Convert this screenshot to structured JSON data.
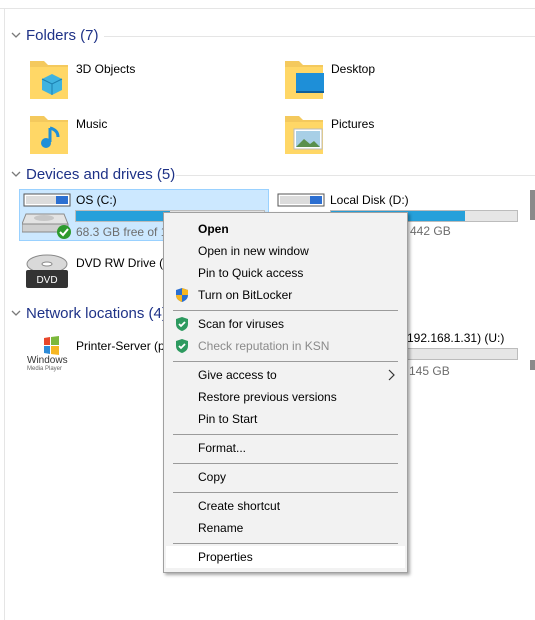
{
  "sections": {
    "folders": "Folders (7)",
    "devices": "Devices and drives (5)",
    "network": "Network locations (4)"
  },
  "folders": [
    {
      "label": "3D Objects",
      "icon": "3d-objects-folder-icon"
    },
    {
      "label": "Desktop",
      "icon": "desktop-folder-icon"
    },
    {
      "label": "Music",
      "icon": "music-folder-icon"
    },
    {
      "label": "Pictures",
      "icon": "pictures-folder-icon"
    }
  ],
  "drives": {
    "os": {
      "label": "OS (C:)",
      "free": "68.3 GB free of 1",
      "used_fraction": 0.5
    },
    "local_d": {
      "label": "Local Disk (D:)",
      "free": "442 GB",
      "used_fraction": 0.8
    },
    "dvd": {
      "label": "DVD RW Drive (G"
    },
    "dvd_icon_text": "DVD"
  },
  "network": {
    "printer": {
      "label": "Printer-Server (p",
      "logo_line1": "Windows",
      "logo_line2": "Media Player"
    },
    "share": {
      "label": "(192.168.1.31) (U:)",
      "free": "145 GB"
    }
  },
  "context_menu": {
    "open": "Open",
    "open_new_window": "Open in new window",
    "pin_quick_access": "Pin to Quick access",
    "bitlocker": "Turn on BitLocker",
    "scan_viruses": "Scan for viruses",
    "check_ksn": "Check reputation in KSN",
    "give_access": "Give access to",
    "restore_versions": "Restore previous versions",
    "pin_start": "Pin to Start",
    "format": "Format...",
    "copy": "Copy",
    "create_shortcut": "Create shortcut",
    "rename": "Rename",
    "properties": "Properties"
  },
  "colors": {
    "section_header": "#1e3287",
    "selection_fill": "#cce8ff",
    "drive_bar": "#26a0da",
    "kaspersky_green": "#2d9a5f"
  }
}
